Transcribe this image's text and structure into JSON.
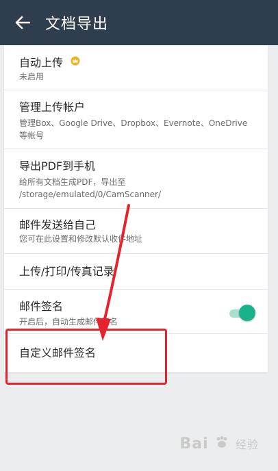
{
  "header": {
    "title": "文档导出",
    "bg_color": "#2f3e4e"
  },
  "items": [
    {
      "title": "自动上传",
      "subtitle": "未启用",
      "badge_icon": "crown-icon"
    },
    {
      "title": "管理上传帐户",
      "subtitle_line1": "管理Box、Google Drive、Dropbox、Evernote、OneDrive",
      "subtitle_line2": "等帐号"
    },
    {
      "title": "导出PDF到手机",
      "subtitle_line1": "给所有文档生成PDF，导出至",
      "subtitle_line2": "/storage/emulated/0/CamScanner/"
    },
    {
      "title": "邮件发送给自己",
      "subtitle": "您可在此设置和修改默认收件地址"
    },
    {
      "title": "上传/打印/传真记录"
    },
    {
      "title": "邮件签名",
      "subtitle": "开启后，自动生成邮件签名",
      "toggle_on": true
    },
    {
      "title": "自定义邮件签名"
    }
  ],
  "accent_color": "#19b38a",
  "annotation_color": "#e5232d",
  "watermark": {
    "brand": "Bai",
    "suffix": "经验"
  }
}
